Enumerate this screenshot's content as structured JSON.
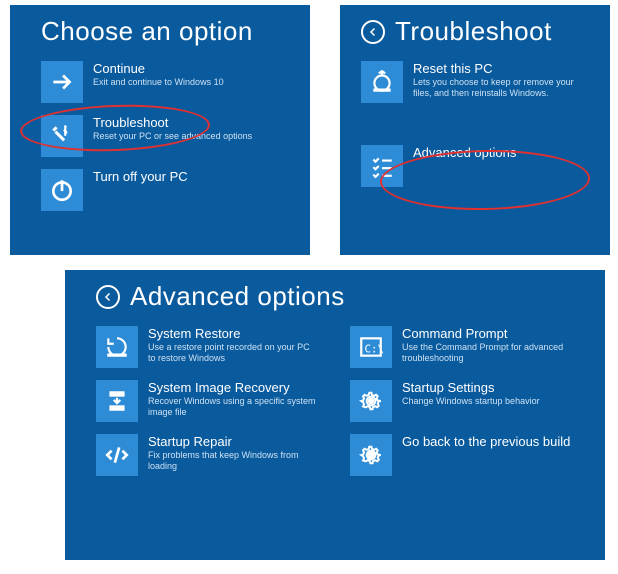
{
  "choose": {
    "title": "Choose an option",
    "items": [
      {
        "title": "Continue",
        "sub": "Exit and continue to Windows 10"
      },
      {
        "title": "Troubleshoot",
        "sub": "Reset your PC or see advanced options"
      },
      {
        "title": "Turn off your PC",
        "sub": ""
      }
    ]
  },
  "trouble": {
    "title": "Troubleshoot",
    "items": [
      {
        "title": "Reset this PC",
        "sub": "Lets you choose to keep or remove your files, and then reinstalls Windows."
      },
      {
        "title": "Advanced options",
        "sub": ""
      }
    ]
  },
  "advanced": {
    "title": "Advanced options",
    "left": [
      {
        "title": "System Restore",
        "sub": "Use a restore point recorded on your PC to restore Windows"
      },
      {
        "title": "System Image Recovery",
        "sub": "Recover Windows using a specific system image file"
      },
      {
        "title": "Startup Repair",
        "sub": "Fix problems that keep Windows from loading"
      }
    ],
    "right": [
      {
        "title": "Command Prompt",
        "sub": "Use the Command Prompt for advanced troubleshooting"
      },
      {
        "title": "Startup Settings",
        "sub": "Change Windows startup behavior"
      },
      {
        "title": "Go back to the previous build",
        "sub": ""
      }
    ]
  }
}
